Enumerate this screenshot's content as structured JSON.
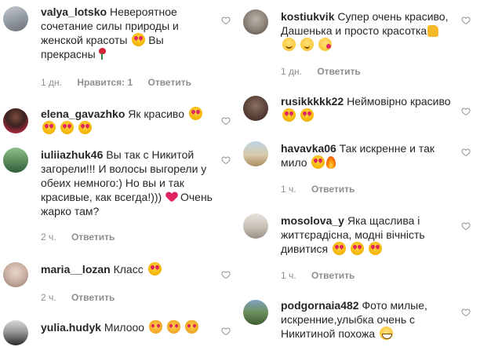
{
  "left": [
    {
      "user": "valya_lotsko",
      "text": "Невероятное сочетание силы природы и женской красоты",
      "text2": "Вы прекрасны",
      "time": "1 дн.",
      "likes": "Нравится: 1",
      "reply": "Ответить"
    },
    {
      "user": "elena_gavazhko",
      "text": "Як красиво"
    },
    {
      "user": "iuliiazhuk46",
      "text": "Вы так с Никитой загорели!!! И волосы выгорели у обеих немного:) Но вы и так красивые, как всегда!)))",
      "text2": "Очень жарко там?",
      "time": "2 ч.",
      "reply": "Ответить"
    },
    {
      "user": "maria__lozan",
      "text": "Класс",
      "time": "2 ч.",
      "reply": "Ответить"
    },
    {
      "user": "yulia.hudyk",
      "text": "Милооо"
    }
  ],
  "right": [
    {
      "user": "kostiukvik",
      "text": "Супер очень красиво, Дашенька и просто красотка",
      "time": "1 дн.",
      "reply": "Ответить"
    },
    {
      "user": "rusikkkkk22",
      "text": "Неймовірно красиво"
    },
    {
      "user": "havavka06",
      "text": "Так искренне и так мило",
      "time": "1 ч.",
      "reply": "Ответить"
    },
    {
      "user": "mosolova_y",
      "text": "Яка щаслива і життєрадісна, модні вічність дивитися",
      "time": "1 ч.",
      "reply": "Ответить"
    },
    {
      "user": "podgornaia482",
      "text": "Фото милые, искренние,улыбка очень с Никитиной похожа"
    }
  ],
  "icons": {
    "like": "heart-outline-icon",
    "emoji_heart_eyes": "heart-eyes-emoji-icon",
    "emoji_rose": "rose-emoji-icon",
    "emoji_heart": "red-heart-emoji-icon",
    "emoji_fire": "fire-emoji-icon",
    "emoji_cat": "heart-eyes-cat-emoji-icon",
    "emoji_thumb": "thumbs-up-emoji-icon",
    "emoji_smile": "smile-emoji-icon",
    "emoji_wink": "wink-emoji-icon",
    "emoji_kiss": "kiss-emoji-icon",
    "emoji_grin": "grin-emoji-icon"
  },
  "colors": {
    "text": "#262626",
    "meta": "#8e8e8e",
    "heart": "#e0245e"
  }
}
